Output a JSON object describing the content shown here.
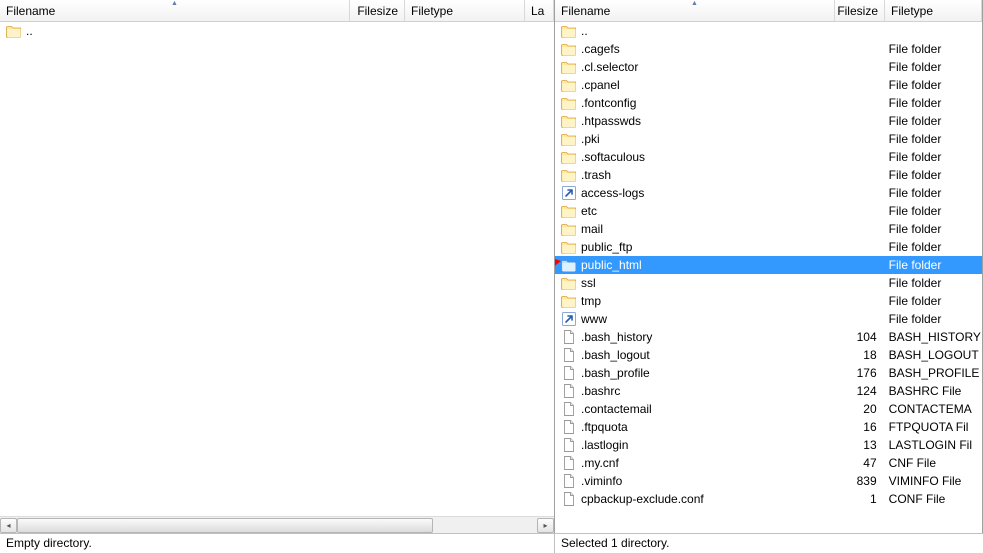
{
  "columns": {
    "filename": "Filename",
    "filesize": "Filesize",
    "filetype": "Filetype",
    "last": "La"
  },
  "left": {
    "cols": {
      "name": 350,
      "size": 55,
      "type": 120,
      "last": 30
    },
    "rows": [
      {
        "icon": "folder-up",
        "name": "..",
        "size": "",
        "type": ""
      }
    ],
    "status": "Empty directory."
  },
  "right": {
    "cols": {
      "name": 280,
      "size": 50,
      "type": 100
    },
    "rows": [
      {
        "icon": "folder-up",
        "name": "..",
        "size": "",
        "type": ""
      },
      {
        "icon": "folder",
        "name": ".cagefs",
        "size": "",
        "type": "File folder"
      },
      {
        "icon": "folder",
        "name": ".cl.selector",
        "size": "",
        "type": "File folder"
      },
      {
        "icon": "folder",
        "name": ".cpanel",
        "size": "",
        "type": "File folder"
      },
      {
        "icon": "folder",
        "name": ".fontconfig",
        "size": "",
        "type": "File folder"
      },
      {
        "icon": "folder",
        "name": ".htpasswds",
        "size": "",
        "type": "File folder"
      },
      {
        "icon": "folder",
        "name": ".pki",
        "size": "",
        "type": "File folder"
      },
      {
        "icon": "folder",
        "name": ".softaculous",
        "size": "",
        "type": "File folder"
      },
      {
        "icon": "folder",
        "name": ".trash",
        "size": "",
        "type": "File folder"
      },
      {
        "icon": "shortcut",
        "name": "access-logs",
        "size": "",
        "type": "File folder"
      },
      {
        "icon": "folder",
        "name": "etc",
        "size": "",
        "type": "File folder"
      },
      {
        "icon": "folder",
        "name": "mail",
        "size": "",
        "type": "File folder"
      },
      {
        "icon": "folder",
        "name": "public_ftp",
        "size": "",
        "type": "File folder"
      },
      {
        "icon": "folder",
        "name": "public_html",
        "size": "",
        "type": "File folder",
        "selected": true
      },
      {
        "icon": "folder",
        "name": "ssl",
        "size": "",
        "type": "File folder"
      },
      {
        "icon": "folder",
        "name": "tmp",
        "size": "",
        "type": "File folder"
      },
      {
        "icon": "shortcut",
        "name": "www",
        "size": "",
        "type": "File folder"
      },
      {
        "icon": "file",
        "name": ".bash_history",
        "size": "104",
        "type": "BASH_HISTORY"
      },
      {
        "icon": "file",
        "name": ".bash_logout",
        "size": "18",
        "type": "BASH_LOGOUT"
      },
      {
        "icon": "file",
        "name": ".bash_profile",
        "size": "176",
        "type": "BASH_PROFILE"
      },
      {
        "icon": "file",
        "name": ".bashrc",
        "size": "124",
        "type": "BASHRC File"
      },
      {
        "icon": "file",
        "name": ".contactemail",
        "size": "20",
        "type": "CONTACTEMA"
      },
      {
        "icon": "file",
        "name": ".ftpquota",
        "size": "16",
        "type": "FTPQUOTA Fil"
      },
      {
        "icon": "file",
        "name": ".lastlogin",
        "size": "13",
        "type": "LASTLOGIN Fil"
      },
      {
        "icon": "file",
        "name": ".my.cnf",
        "size": "47",
        "type": "CNF File"
      },
      {
        "icon": "file",
        "name": ".viminfo",
        "size": "839",
        "type": "VIMINFO File"
      },
      {
        "icon": "file",
        "name": "cpbackup-exclude.conf",
        "size": "1",
        "type": "CONF File"
      }
    ],
    "status": "Selected 1 directory."
  }
}
